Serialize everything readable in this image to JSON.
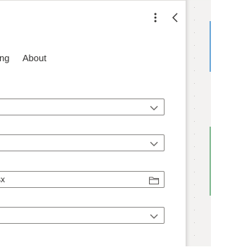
{
  "header": {
    "more_icon": "more-vertical-icon",
    "collapse_icon": "chevron-left-icon"
  },
  "tabs": [
    {
      "label": "ng"
    },
    {
      "label": "About"
    }
  ],
  "fields": [
    {
      "value": "",
      "icon": "chevron-down-icon"
    },
    {
      "value": "",
      "icon": "chevron-down-icon"
    },
    {
      "value": "sx",
      "icon": "folder-icon"
    },
    {
      "value": "",
      "icon": "chevron-down-icon"
    }
  ],
  "colors": {
    "border": "#8a8886",
    "text": "#323130",
    "side_strip": "#f3f2f1",
    "accent": "#6aa7d8"
  }
}
